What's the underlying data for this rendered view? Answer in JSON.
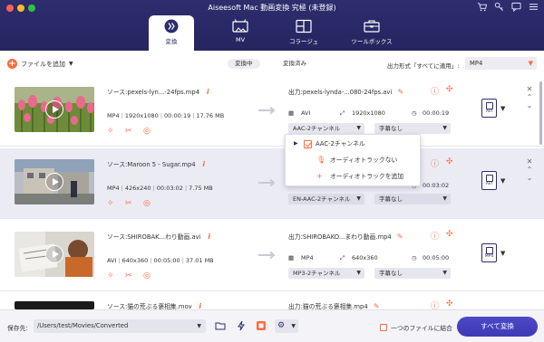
{
  "window": {
    "title": "Aiseesoft Mac 動画変換 究極 (未登録)"
  },
  "titlebar_icons": [
    "cart-icon",
    "key-icon",
    "chat-icon",
    "menu-icon"
  ],
  "tabs": [
    {
      "label": "変換",
      "icon": "convert-icon",
      "active": true
    },
    {
      "label": "MV",
      "icon": "mv-icon",
      "active": false
    },
    {
      "label": "コラージュ",
      "icon": "collage-icon",
      "active": false
    },
    {
      "label": "ツールボックス",
      "icon": "toolbox-icon",
      "active": false
    }
  ],
  "toolbar": {
    "add_file_label": "ファイルを追加",
    "segment_converting": "変換中",
    "segment_converted": "変換済み",
    "output_format_label": "出力形式「すべてに適用」:",
    "output_format_value": "MP4"
  },
  "items": [
    {
      "source_name": "ソース:pexels-lyn...-24fps.mp4",
      "format": "MP4",
      "resolution": "1920x1080",
      "duration": "00:00:19",
      "size": "17.76 MB",
      "output_name": "出力:pexels-lynda-...080-24fps.avi",
      "out_format": "AVI",
      "out_resolution": "1920x1080",
      "out_duration": "00:00:19",
      "audio_track": "AAC-2チャンネル",
      "subtitle": "字幕なし",
      "badge": "AVI"
    },
    {
      "source_name": "ソース:Maroon 5 - Sugar.mp4",
      "format": "MP4",
      "resolution": "426x240",
      "duration": "00:03:02",
      "size": "7.75 MB",
      "output_name": "",
      "out_format": "",
      "out_resolution": "",
      "out_duration": "00:03:02",
      "audio_track": "EN-AAC-2チャンネル",
      "subtitle": "字幕なし",
      "badge": "AVI"
    },
    {
      "source_name": "ソース:SHIROBAK...わり動画.avi",
      "format": "AVI",
      "resolution": "640x360",
      "duration": "00:05:00",
      "size": "37.01 MB",
      "output_name": "出力:SHIROBAKO...まわり動画.mp4",
      "out_format": "MP4",
      "out_resolution": "640x360",
      "out_duration": "00:05:00",
      "audio_track": "MP3-2チャンネル",
      "subtitle": "字幕なし",
      "badge": "MP4"
    },
    {
      "source_name": "ソース:猫の荒ぶる褒相集.mov",
      "output_name": "出力:猫の荒ぶる褒相集.mp4"
    }
  ],
  "audio_menu": {
    "selected": "AAC-2チャンネル",
    "no_audio": "オーディオトラックない",
    "add_audio": "オーディオトラックを追加"
  },
  "footer": {
    "save_label": "保存先:",
    "save_path": "/Users/test/Movies/Converted",
    "merge_label": "一つのファイルに結合",
    "convert_all": "すべて変換"
  },
  "colors": {
    "header_bg": "#2e2d6e",
    "accent": "#ff6a3d",
    "convert_button": "#4541bd"
  }
}
